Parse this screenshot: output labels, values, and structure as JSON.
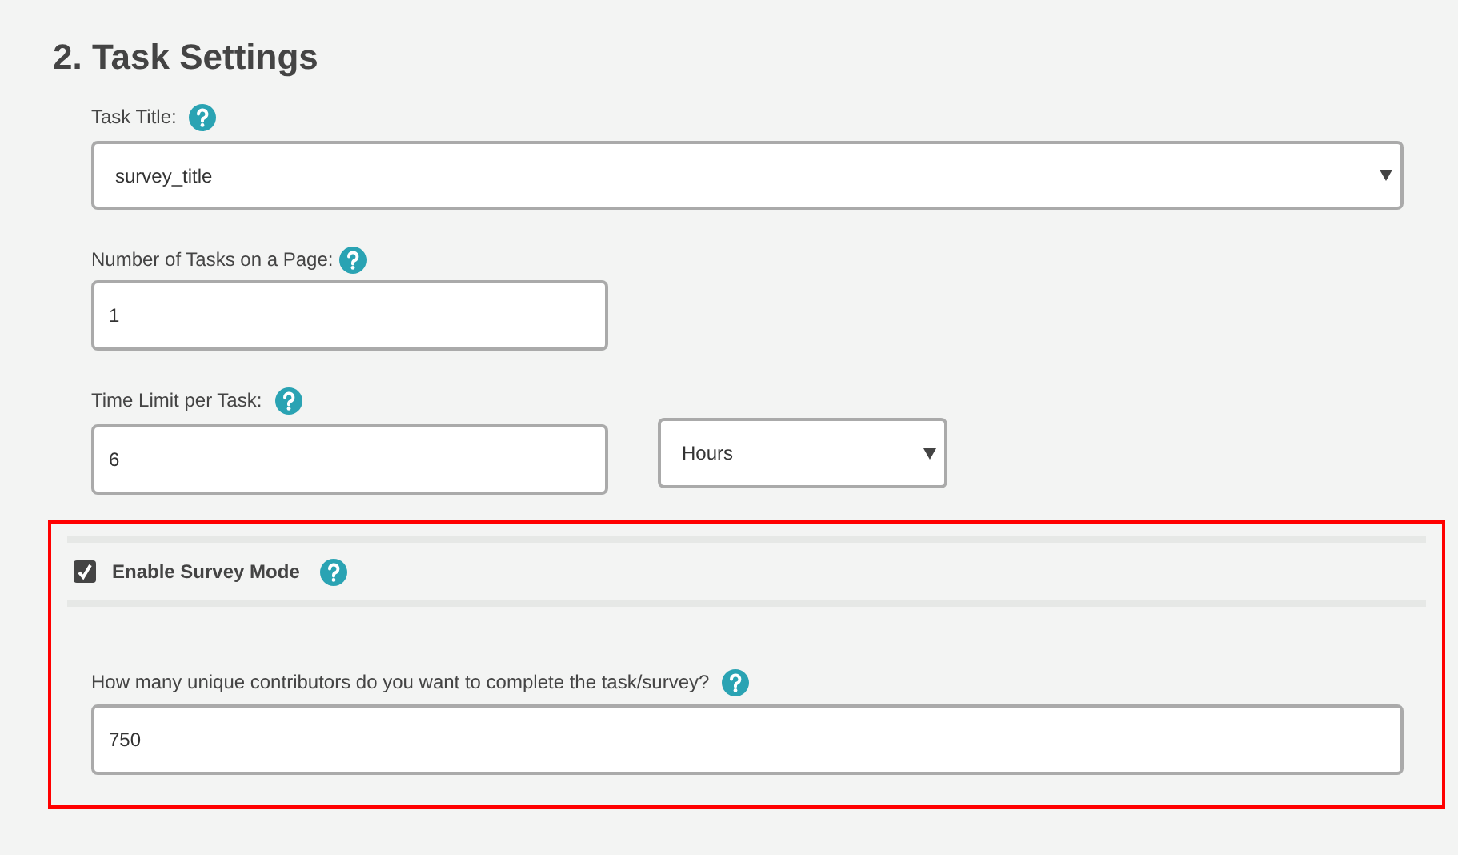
{
  "section_title": "2. Task Settings",
  "task_title": {
    "label": "Task Title:",
    "value": "survey_title"
  },
  "tasks_per_page": {
    "label": "Number of Tasks on a Page:",
    "value": "1"
  },
  "time_limit": {
    "label": "Time Limit per Task:",
    "value": "6",
    "unit": "Hours"
  },
  "survey_mode": {
    "label": "Enable Survey Mode",
    "checked": true
  },
  "contributors": {
    "label": "How many unique contributors do you want to complete the task/survey?",
    "value": "750"
  }
}
